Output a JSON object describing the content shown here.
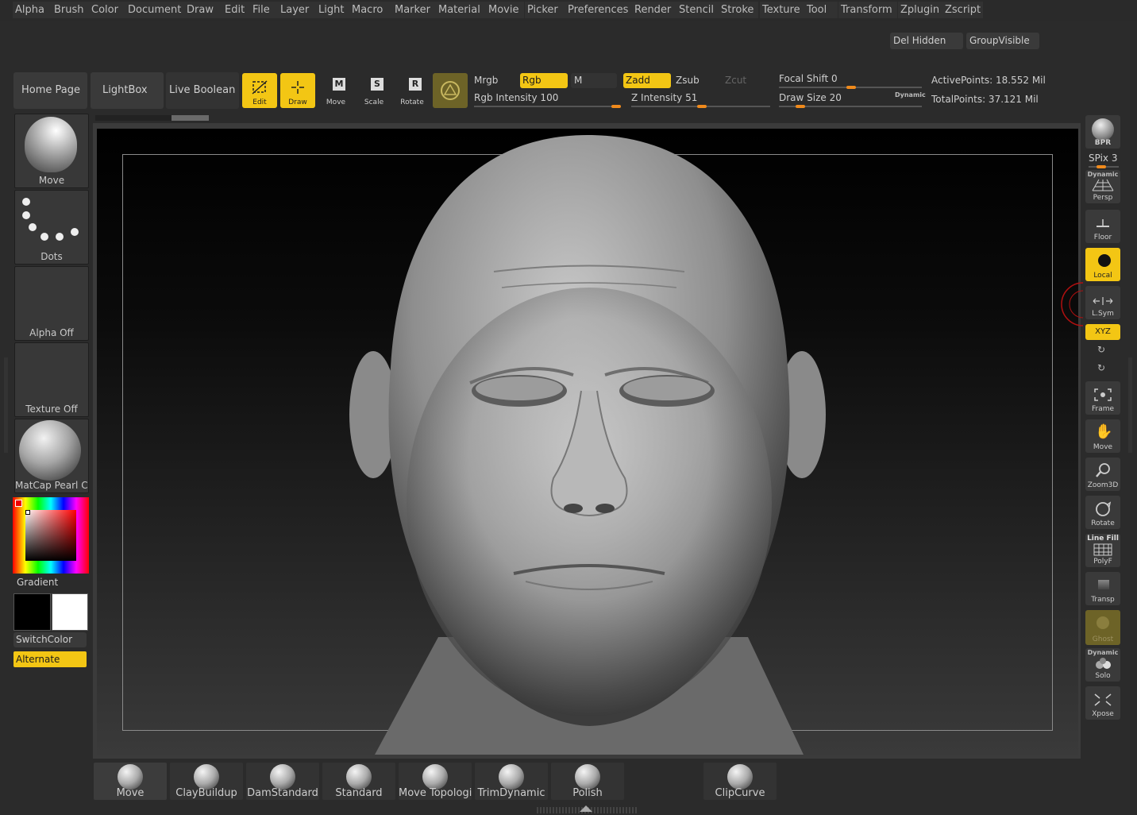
{
  "menu": [
    "Alpha",
    "Brush",
    "Color",
    "Document",
    "Draw",
    "Edit",
    "File",
    "Layer",
    "Light",
    "Macro",
    "Marker",
    "Material",
    "Movie",
    "Picker",
    "Preferences",
    "Render",
    "Stencil",
    "Stroke",
    "Texture",
    "Tool",
    "Transform",
    "Zplugin",
    "Zscript"
  ],
  "top_right": {
    "del_hidden": "Del Hidden",
    "group_visible": "GroupVisible"
  },
  "toolbar": {
    "home_page": "Home Page",
    "lightbox": "LightBox",
    "live_boolean": "Live Boolean",
    "edit": "Edit",
    "draw": "Draw",
    "move": "Move",
    "scale": "Scale",
    "rotate": "Rotate",
    "mrgb": "Mrgb",
    "rgb": "Rgb",
    "m": "M",
    "zadd": "Zadd",
    "zsub": "Zsub",
    "zcut": "Zcut",
    "rgb_intensity": "Rgb Intensity 100",
    "z_intensity": "Z Intensity 51",
    "focal_shift": "Focal Shift 0",
    "draw_size": "Draw Size 20",
    "dynamic": "Dynamic",
    "active_points": "ActivePoints: 18.552 Mil",
    "total_points": "TotalPoints: 37.121 Mil",
    "rgb_intensity_value": 100,
    "z_intensity_value": 51,
    "focal_shift_value": 0,
    "draw_size_value": 20
  },
  "left_panel": {
    "brush": "Move",
    "stroke": "Dots",
    "alpha": "Alpha Off",
    "texture": "Texture Off",
    "material": "MatCap Pearl Ca",
    "gradient": "Gradient",
    "switch_color": "SwitchColor",
    "alternate": "Alternate"
  },
  "right_shelf": {
    "bpr": "BPR",
    "spix": "SPix 3",
    "dynamic": "Dynamic",
    "persp": "Persp",
    "floor": "Floor",
    "local": "Local",
    "lsym": "L.Sym",
    "xyz": "XYZ",
    "frame": "Frame",
    "move": "Move",
    "zoom3d": "Zoom3D",
    "rotate": "Rotate",
    "line_fill": "Line Fill",
    "polyf": "PolyF",
    "transp": "Transp",
    "ghost": "Ghost",
    "dynamic2": "Dynamic",
    "solo": "Solo",
    "xpose": "Xpose"
  },
  "bottom_brushes": [
    "Move",
    "ClayBuildup",
    "DamStandard",
    "Standard",
    "Move Topologica",
    "TrimDynamic",
    "Polish",
    "ClipCurve"
  ],
  "colors": {
    "accent": "#f3c614",
    "slider": "#f08a1c",
    "bg": "#2b2b2b",
    "canvas": "#000000"
  }
}
